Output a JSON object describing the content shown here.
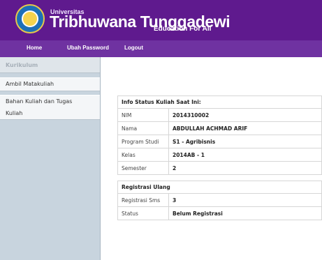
{
  "header": {
    "brand_small": "Universitas",
    "brand_big": "Tribhuwana Tunggadewi",
    "tagline": "Education For All",
    "logo_icon": "university-seal-icon",
    "colors": {
      "header_bg": "#5f1a8e",
      "nav_bg": "#6f32a1",
      "accent": "#f4d34e"
    }
  },
  "nav": {
    "home": "Home",
    "change_password": "Ubah Password",
    "logout": "Logout"
  },
  "sidebar": {
    "heading": "Kurikulum",
    "items": [
      {
        "label": "Ambil Matakuliah"
      },
      {
        "label_line1": "Bahan Kuliah dan Tugas",
        "label_line2": "Kuliah"
      }
    ]
  },
  "status": {
    "title": "Info Status Kuliah Saat Ini:",
    "rows": [
      {
        "label": "NIM",
        "value": "2014310002"
      },
      {
        "label": "Nama",
        "value": "ABDULLAH ACHMAD ARIF"
      },
      {
        "label": "Program Studi",
        "value": "S1 - Agribisnis"
      },
      {
        "label": "Kelas",
        "value": "2014AB - 1"
      },
      {
        "label": "Semester",
        "value": "2"
      }
    ]
  },
  "registration": {
    "title": "Registrasi Ulang",
    "rows": [
      {
        "label": "Registrasi Sms",
        "value": "3"
      },
      {
        "label": "Status",
        "value": "Belum Registrasi"
      }
    ]
  }
}
